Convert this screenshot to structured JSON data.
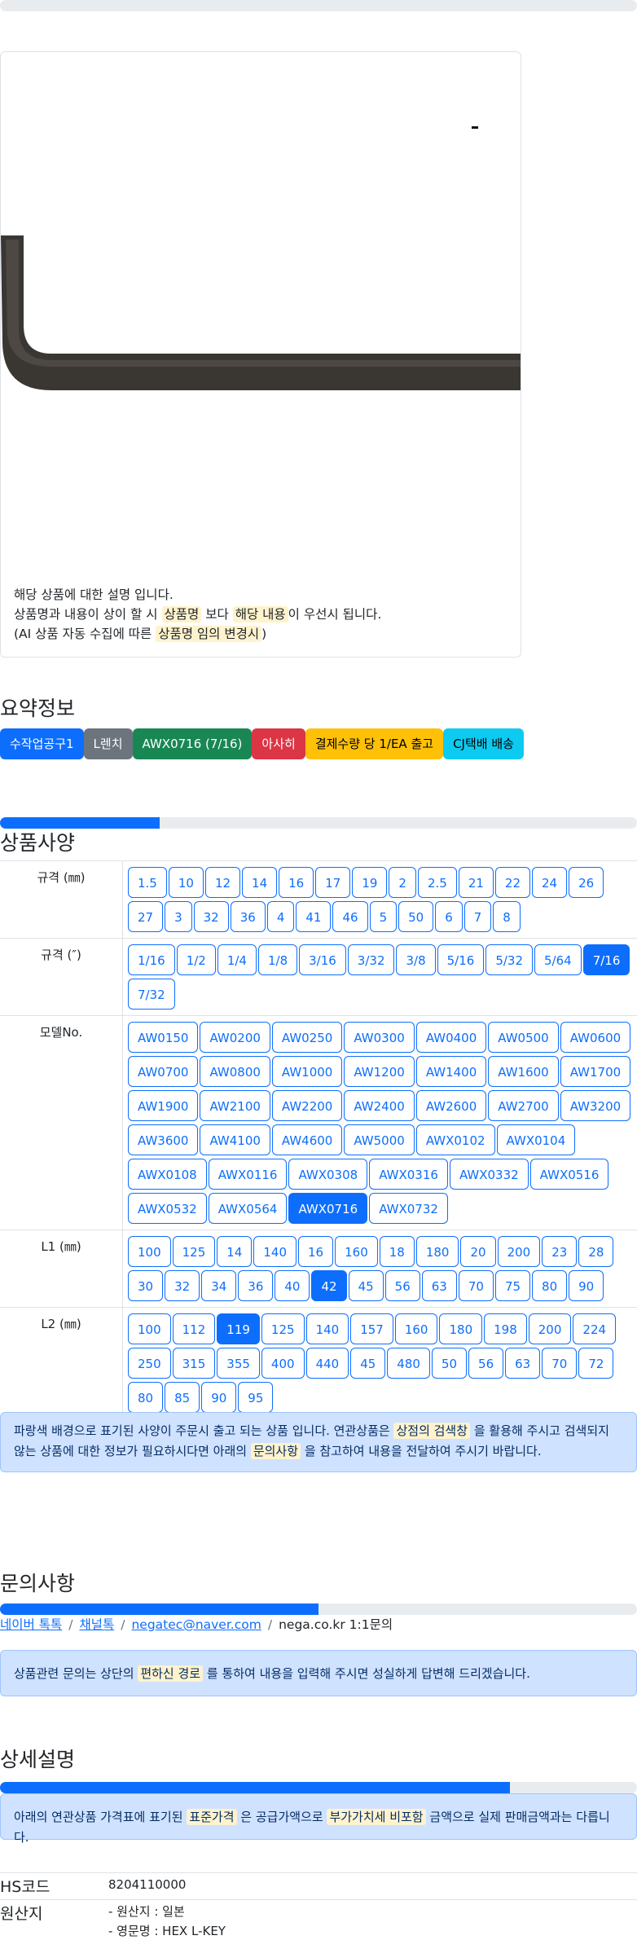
{
  "image_caption": {
    "line1": "해당 상품에 대한 설명 입니다.",
    "line2_pre": "상품명과 내용이 상이 할 시",
    "line2_hl1": "상품명",
    "line2_mid": "보다",
    "line2_hl2": "해당 내용",
    "line2_post": "이 우선시 됩니다.",
    "line3_pre": "(AI 상품 자동 수집에 따른",
    "line3_hl": "상품명 임의 변경시",
    "line3_post": ")"
  },
  "summary": {
    "title": "요약정보",
    "badges": [
      {
        "label": "수작업공구1",
        "color": "#0d6efd"
      },
      {
        "label": "L렌치",
        "color": "#6c757d"
      },
      {
        "label": "AWX0716 (7/16)",
        "color": "#198754"
      },
      {
        "label": "아사히",
        "color": "#dc3545"
      },
      {
        "label": "결제수량 당 1/EA 출고",
        "color": "#ffc107"
      },
      {
        "label": "CJ택배 배송",
        "color": "#0dcaf0"
      }
    ]
  },
  "spec": {
    "title": "상품사양",
    "progress": 0.25,
    "rows": [
      {
        "label": "규격 (㎜)",
        "options": [
          "1.5",
          "10",
          "12",
          "14",
          "16",
          "17",
          "19",
          "2",
          "2.5",
          "21",
          "22",
          "24",
          "26",
          "27",
          "3",
          "32",
          "36",
          "4",
          "41",
          "46",
          "5",
          "50",
          "6",
          "7",
          "8"
        ],
        "active": null
      },
      {
        "label": "규격 (″)",
        "options": [
          "1/16",
          "1/2",
          "1/4",
          "1/8",
          "3/16",
          "3/32",
          "3/8",
          "5/16",
          "5/32",
          "5/64",
          "7/16",
          "7/32"
        ],
        "active": "7/16"
      },
      {
        "label": "모델No.",
        "options": [
          "AW0150",
          "AW0200",
          "AW0250",
          "AW0300",
          "AW0400",
          "AW0500",
          "AW0600",
          "AW0700",
          "AW0800",
          "AW1000",
          "AW1200",
          "AW1400",
          "AW1600",
          "AW1700",
          "AW1900",
          "AW2100",
          "AW2200",
          "AW2400",
          "AW2600",
          "AW2700",
          "AW3200",
          "AW3600",
          "AW4100",
          "AW4600",
          "AW5000",
          "AWX0102",
          "AWX0104",
          "AWX0108",
          "AWX0116",
          "AWX0308",
          "AWX0316",
          "AWX0332",
          "AWX0516",
          "AWX0532",
          "AWX0564",
          "AWX0716",
          "AWX0732"
        ],
        "active": "AWX0716"
      },
      {
        "label": "L1 (㎜)",
        "options": [
          "100",
          "125",
          "14",
          "140",
          "16",
          "160",
          "18",
          "180",
          "20",
          "200",
          "23",
          "28",
          "30",
          "32",
          "34",
          "36",
          "40",
          "42",
          "45",
          "56",
          "63",
          "70",
          "75",
          "80",
          "90"
        ],
        "active": "42"
      },
      {
        "label": "L2 (㎜)",
        "options": [
          "100",
          "112",
          "119",
          "125",
          "140",
          "157",
          "160",
          "180",
          "198",
          "200",
          "224",
          "250",
          "315",
          "355",
          "400",
          "440",
          "45",
          "480",
          "50",
          "56",
          "63",
          "70",
          "72",
          "80",
          "85",
          "90",
          "95"
        ],
        "active": "119"
      }
    ],
    "notice_pre": "파랑색 배경으로 표기된 사양이 주문시 출고 되는 상품 입니다. 연관상품은",
    "notice_hl1": "상점의 검색창",
    "notice_mid": "을 활용해 주시고 검색되지 않는 상품에 대한 정보가 필요하시다면 아래의",
    "notice_hl2": "문의사항",
    "notice_post": "을 참고하여 내용을 전달하여 주시기 바랍니다."
  },
  "inquiry": {
    "title": "문의사항",
    "progress": 0.5,
    "links": [
      "네이버 톡톡",
      "채널톡",
      "negatec@naver.com"
    ],
    "plain": "nega.co.kr 1:1문의",
    "notice_pre": "상품관련 문의는 상단의",
    "notice_hl": "편하신 경로",
    "notice_post": "를 통하여 내용을 입력해 주시면 성실하게 답변해 드리겠습니다."
  },
  "detail": {
    "title": "상세설명",
    "progress": 0.8,
    "notice_pre": "아래의 연관상품 가격표에 표기된",
    "notice_hl1": "표준가격",
    "notice_mid": "은 공급가액으로",
    "notice_hl2": "부가가치세 비포함",
    "notice_post": "금액으로 실제 판매금액과는 다릅니다.",
    "hs_key": "HS코드",
    "hs_val": "8204110000",
    "origin_key": "원산지",
    "origin_line1": "- 원산지 : 일본",
    "origin_line2": "- 영문명 : HEX L-KEY"
  }
}
